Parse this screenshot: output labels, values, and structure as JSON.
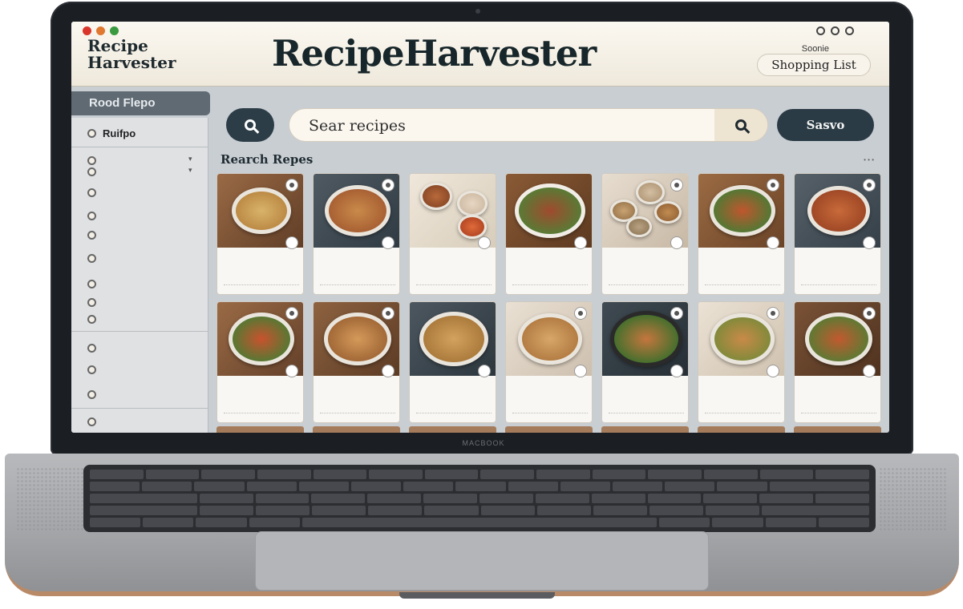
{
  "header": {
    "logo_text": "Recipe Harvester",
    "brand_title": "RecipeHarvester",
    "shopping_small": "Soonie",
    "shopping_button": "Shopping List"
  },
  "sidebar": {
    "top_label": "Rood Flepo",
    "main_item": "Ruifpo"
  },
  "search": {
    "placeholder": "Sear recipes",
    "save_label": "Sasvo"
  },
  "section": {
    "title": "Rearch Repes"
  },
  "colors": {
    "header_bg": "#f5f0e6",
    "primary_button": "#2b3b45",
    "sidebar_header": "#5f6a73",
    "window_dot_red": "#d9352b",
    "window_dot_orange": "#e0782f",
    "window_dot_green": "#3b9a3f"
  },
  "icons": [
    "search-icon",
    "settings-icon",
    "account-icon",
    "favorite-icon",
    "more-icon"
  ],
  "hinge_text": "MACBOOK"
}
